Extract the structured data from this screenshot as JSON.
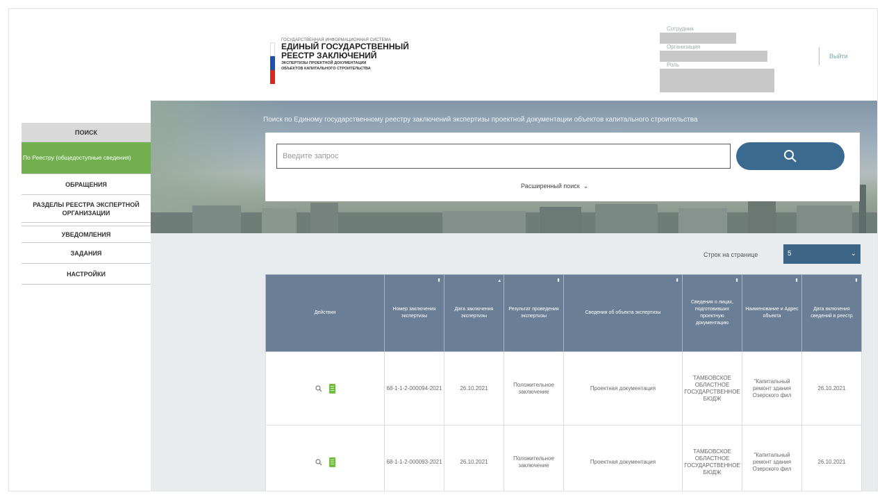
{
  "header": {
    "logo_small": "ГОСУДАРСТВЕННАЯ ИНФОРМАЦИОННАЯ СИСТЕМА",
    "logo_line1": "ЕДИНЫЙ ГОСУДАРСТВЕННЫЙ",
    "logo_line2": "РЕЕСТР ЗАКЛЮЧЕНИЙ",
    "logo_sub1": "ЭКСПЕРТИЗЫ ПРОЕКТНОЙ ДОКУМЕНТАЦИИ",
    "logo_sub2": "ОБЪЕКТОВ КАПИТАЛЬНОГО СТРОИТЕЛЬСТВА",
    "user_labels": [
      "Сотрудник",
      "Организация",
      "Роль"
    ],
    "logout": "Выйти",
    "flag_colors": [
      "#ffffff",
      "#1f4fa8",
      "#d52b1e"
    ]
  },
  "sidebar": {
    "items": [
      {
        "label": "ПОИСК"
      },
      {
        "label": "По Реестру (общедоступные сведения)"
      },
      {
        "label": "ОБРАЩЕНИЯ"
      },
      {
        "label": "РАЗДЕЛЫ РЕЕСТРА ЭКСПЕРТНОЙ ОРГАНИЗАЦИИ"
      },
      {
        "label": "УВЕДОМЛЕНИЯ"
      },
      {
        "label": "ЗАДАНИЯ"
      },
      {
        "label": "НАСТРОЙКИ"
      }
    ]
  },
  "banner": {
    "title": "Поиск по Единому государственному реестру заключений экспертизы проектной документации объектов капитального строительства",
    "search_placeholder": "Введите запрос",
    "advanced": "Расширенный поиск"
  },
  "pager": {
    "label": "Строк на странице",
    "value": "5"
  },
  "table": {
    "columns": [
      "Действия",
      "Номер заключения экспертизы",
      "Дата заключения экспертизы",
      "Результат проведения экспертизы",
      "Сведения об объекта экспертизы",
      "Сведения о лицах, подготовивших проектную документацию",
      "Наименование и Адрес объекта",
      "Дата включения сведений в реестр"
    ],
    "rows": [
      {
        "number": "68-1-1-2-000094-2021",
        "date": "26.10.2021",
        "result": "Положительное заключение",
        "object": "Проектная документация",
        "author": "ТАМБОВСКОЕ ОБЛАСТНОЕ ГОСУДАРСТВЕННОЕ БЮДЖ",
        "name": "\"Капитальный ремонт здания Озерского фил",
        "included": "26.10.2021"
      },
      {
        "number": "68-1-1-2-000093-2021",
        "date": "26.10.2021",
        "result": "Положительное заключение",
        "object": "Проектная документация",
        "author": "ТАМБОВСКОЕ ОБЛАСТНОЕ ГОСУДАРСТВЕННОЕ БЮДЖ",
        "name": "\"Капитальный ремонт здания Озерского фил",
        "included": "26.10.2021"
      }
    ]
  }
}
